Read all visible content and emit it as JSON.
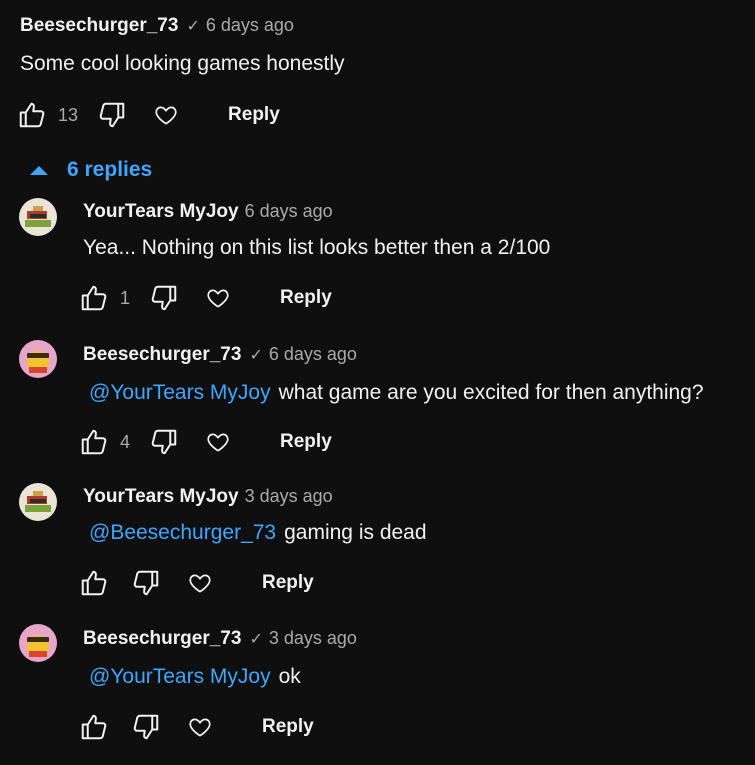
{
  "top_comment": {
    "author": "Beesechurger_73",
    "time": "6 days ago",
    "text": "Some cool looking games honestly",
    "likes": "13",
    "reply_label": "Reply"
  },
  "replies_toggle": {
    "label": "6 replies"
  },
  "replies": [
    {
      "author": "YourTears MyJoy",
      "verified": false,
      "time": "6 days ago",
      "mention": "",
      "text": "Yea... Nothing on this list looks better then a 2/100",
      "likes": "1",
      "reply_label": "Reply"
    },
    {
      "author": "Beesechurger_73",
      "verified": true,
      "time": "6 days ago",
      "mention": "@YourTears MyJoy",
      "text": "what game are you excited for then anything?",
      "likes": "4",
      "reply_label": "Reply"
    },
    {
      "author": "YourTears MyJoy",
      "verified": false,
      "time": "3 days ago",
      "mention": "@Beesechurger_73",
      "text": "gaming is dead",
      "likes": "",
      "reply_label": "Reply"
    },
    {
      "author": "Beesechurger_73",
      "verified": true,
      "time": "3 days ago",
      "mention": "@YourTears MyJoy",
      "text": "ok",
      "likes": "",
      "reply_label": "Reply"
    }
  ],
  "colors": {
    "background": "#0f0f0f",
    "link": "#3ea6ff",
    "muted": "#aaaaaa"
  },
  "icons": [
    "thumbs-up-icon",
    "thumbs-down-icon",
    "heart-icon",
    "check-icon",
    "caret-up-icon"
  ]
}
